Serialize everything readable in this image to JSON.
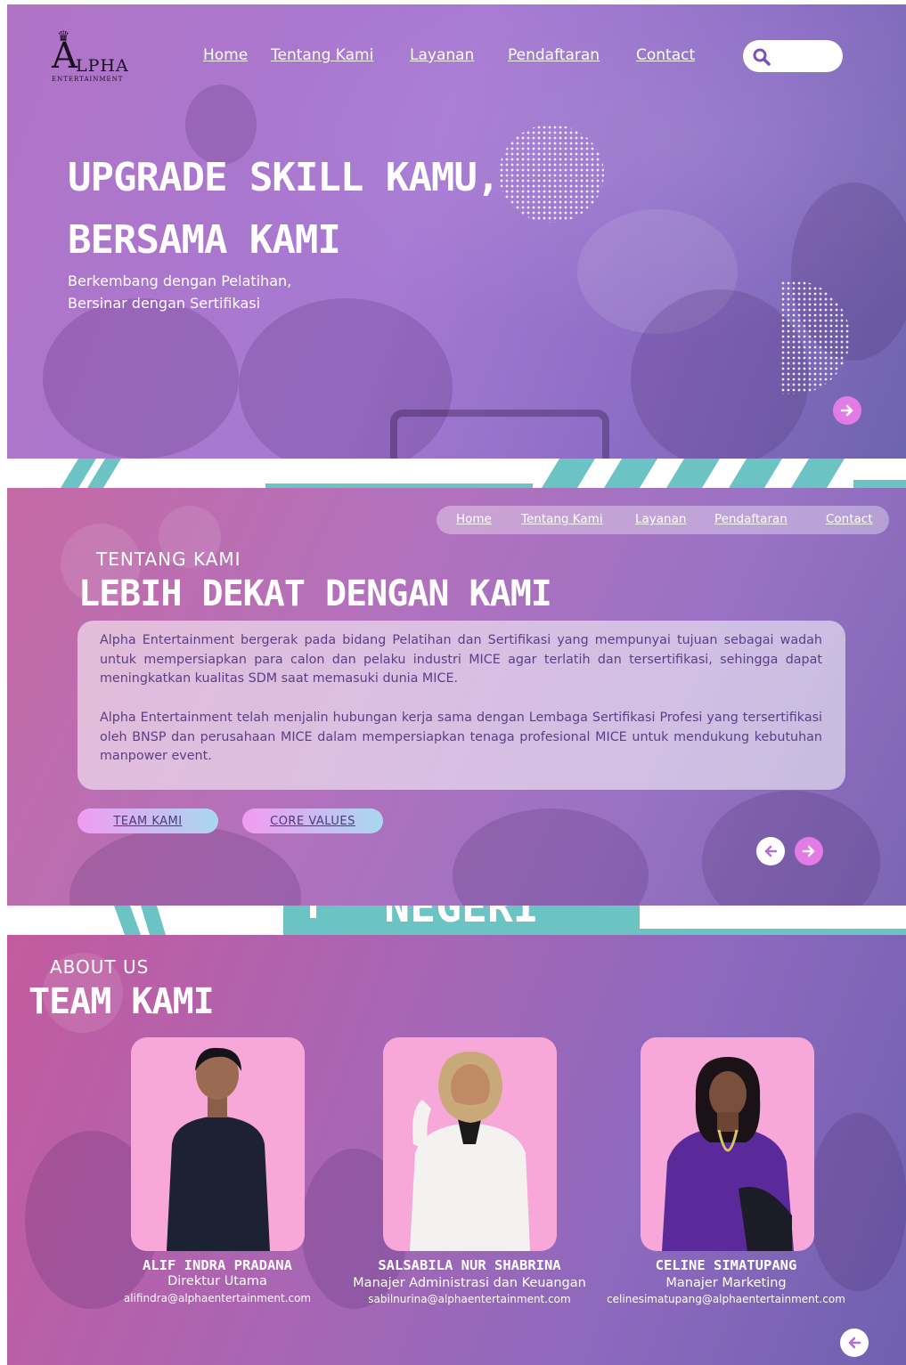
{
  "brand": {
    "logo_letter": "A",
    "logo_rest": "LPHA",
    "logo_sub": "ENTERTAINMENT"
  },
  "nav": [
    "Home",
    "Tentang Kami",
    "Layanan",
    "Pendaftaran",
    "Contact"
  ],
  "hero": {
    "title_line1": "UPGRADE SKILL KAMU,",
    "title_line2": "BERSAMA KAMI",
    "subtitle_line1": "Berkembang dengan Pelatihan,",
    "subtitle_line2": "Bersinar dengan Sertifikasi"
  },
  "band_text": "NEGERI",
  "about": {
    "kicker": "TENTANG KAMI",
    "title": "LEBIH DEKAT DENGAN KAMI",
    "paragraph1": "Alpha Entertainment bergerak pada bidang Pelatihan dan Sertifikasi yang mempunyai tujuan sebagai wadah untuk mempersiapkan para calon dan pelaku industri MICE agar terlatih dan tersertifikasi, sehingga dapat meningkatkan kualitas SDM saat memasuki dunia MICE.",
    "paragraph2": "Alpha Entertainment telah menjalin hubungan kerja sama dengan Lembaga Sertifikasi Profesi yang tersertifikasi oleh BNSP dan perusahaan MICE dalam mempersiapkan tenaga profesional MICE untuk mendukung kebutuhan manpower event.",
    "buttons": [
      "TEAM KAMI",
      "CORE VALUES"
    ]
  },
  "team": {
    "kicker": "ABOUT US",
    "title": "TEAM KAMI",
    "members": [
      {
        "name": "ALIF INDRA PRADANA",
        "role": "Direktur Utama",
        "email": "alifindra@alphaentertainment.com",
        "shirt": "#1c2233"
      },
      {
        "name": "SALSABILA NUR SHABRINA",
        "role": "Manajer Administrasi dan Keuangan",
        "email": "sabilnurina@alphaentertainment.com",
        "shirt": "#f4f2f0"
      },
      {
        "name": "CELINE SIMATUPANG",
        "role": "Manajer Marketing",
        "email": "celinesimatupang@alphaentertainment.com",
        "shirt": "#5b2a9a"
      }
    ]
  },
  "colors": {
    "accent_pink": "#e27be6",
    "card_pink": "#f7a8d8",
    "teal_band": "#6cc3c3"
  }
}
